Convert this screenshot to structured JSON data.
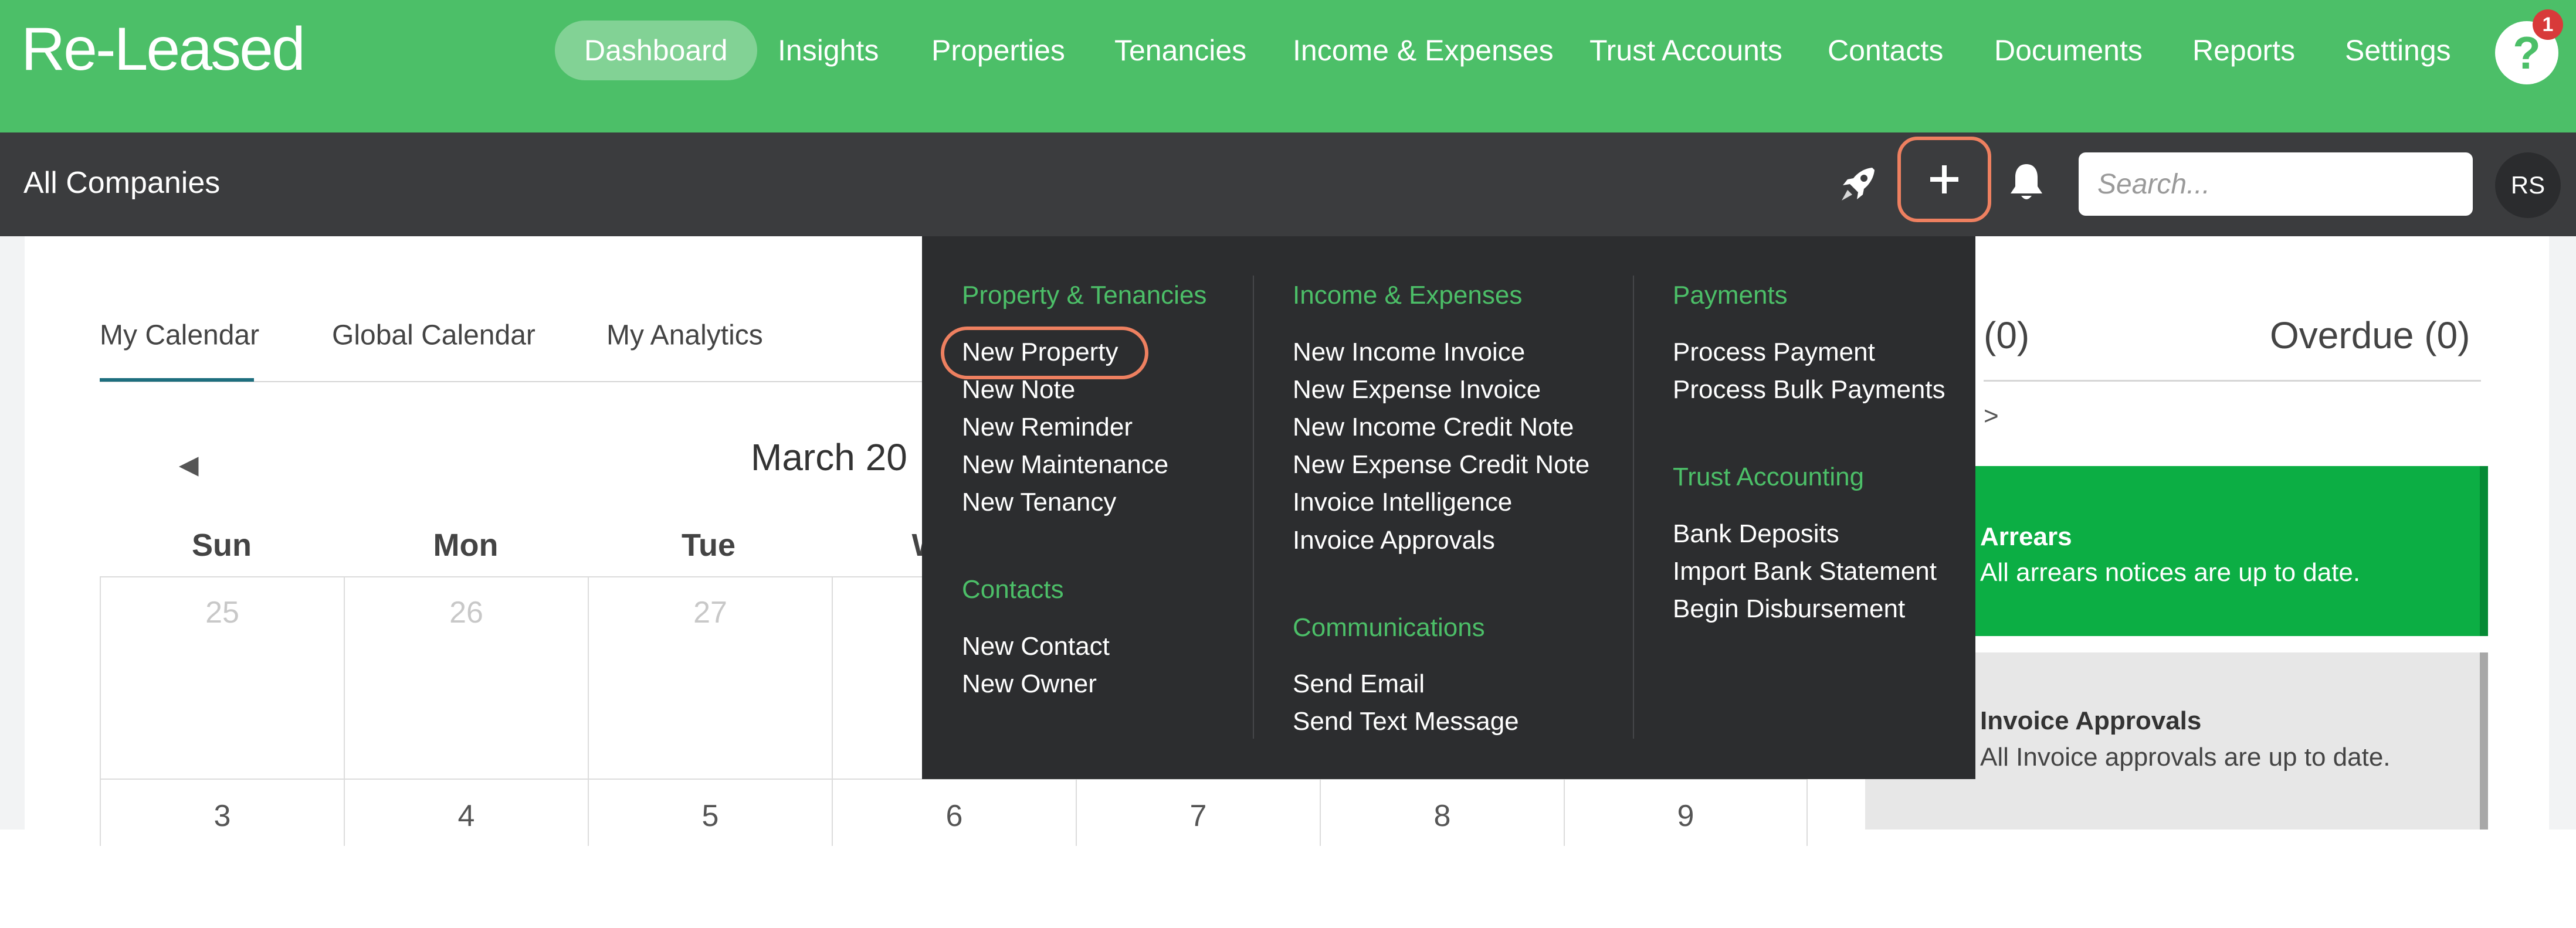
{
  "app": {
    "logo": "Re-Leased"
  },
  "nav": {
    "items": [
      "Dashboard",
      "Insights",
      "Properties",
      "Tenancies",
      "Income & Expenses",
      "Trust Accounts",
      "Contacts",
      "Documents",
      "Reports",
      "Settings"
    ],
    "active": "Dashboard",
    "help_label": "?",
    "help_badge": "1"
  },
  "subbar": {
    "company": "All Companies",
    "search_placeholder": "Search...",
    "avatar_initials": "RS",
    "icons": [
      "rocket-icon",
      "plus-icon",
      "bell-icon"
    ]
  },
  "tabs": [
    "My Calendar",
    "Global Calendar",
    "My Analytics"
  ],
  "calendar": {
    "prev_icon": "◄",
    "month_title": "March 20",
    "day_names": [
      "Sun",
      "Mon",
      "Tue",
      "W"
    ],
    "week1": [
      "25",
      "26",
      "27"
    ],
    "week2": [
      "3",
      "4",
      "5",
      "6",
      "7",
      "8",
      "9"
    ]
  },
  "summary": {
    "left_count": "(0)",
    "overdue": "Overdue (0)",
    "arrow": ">",
    "arrears_title": "Arrears",
    "arrears_text": "All arrears notices are up to date.",
    "approvals_title": "Invoice Approvals",
    "approvals_text": "All Invoice approvals are up to date."
  },
  "quick_menu": {
    "sections": {
      "property_tenancies": {
        "heading": "Property & Tenancies",
        "items": [
          "New Property",
          "New Note",
          "New Reminder",
          "New Maintenance",
          "New Tenancy"
        ]
      },
      "contacts": {
        "heading": "Contacts",
        "items": [
          "New Contact",
          "New Owner"
        ]
      },
      "income_expenses": {
        "heading": "Income & Expenses",
        "items": [
          "New Income Invoice",
          "New Expense Invoice",
          "New Income Credit Note",
          "New Expense Credit Note",
          "Invoice Intelligence",
          "Invoice Approvals"
        ]
      },
      "communications": {
        "heading": "Communications",
        "items": [
          "Send Email",
          "Send Text Message"
        ]
      },
      "payments": {
        "heading": "Payments",
        "items": [
          "Process Payment",
          "Process Bulk Payments"
        ]
      },
      "trust_accounting": {
        "heading": "Trust Accounting",
        "items": [
          "Bank Deposits",
          "Import Bank Statement",
          "Begin Disbursement"
        ]
      }
    }
  },
  "colors": {
    "brand_green": "#4cbf68",
    "dark_bar": "#3b3c3e",
    "menu_bg": "#2c2d2f",
    "highlight": "#ee8060",
    "arrears_green": "#0cae44",
    "tab_underline": "#1d6e7e"
  }
}
